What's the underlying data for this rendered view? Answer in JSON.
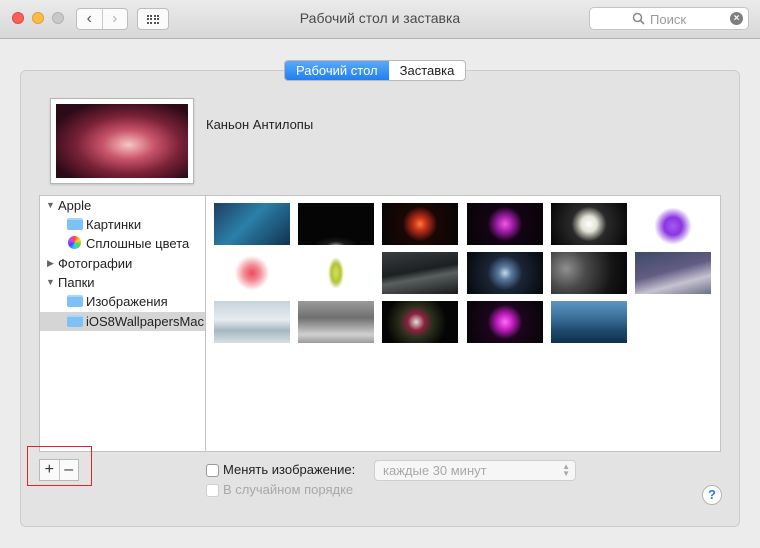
{
  "window": {
    "title": "Рабочий стол и заставка",
    "search_placeholder": "Поиск"
  },
  "tabs": {
    "desktop": "Рабочий стол",
    "screensaver": "Заставка"
  },
  "current_wallpaper": {
    "name": "Каньон Антилопы"
  },
  "sidebar": {
    "apple_group": "Apple",
    "pictures": "Картинки",
    "solid_colors": "Сплошные цвета",
    "photos": "Фотографии",
    "folders_group": "Папки",
    "images_folder": "Изображения",
    "selected_folder": "iOS8WallpapersMac"
  },
  "controls": {
    "add": "+",
    "remove": "–",
    "change_picture_label": "Менять изображение:",
    "interval_value": "каждые 30 минут",
    "random_order_label": "В случайном порядке",
    "help": "?"
  },
  "colors": {
    "accent": "#1f80f2",
    "highlight_box": "#e0242d"
  }
}
